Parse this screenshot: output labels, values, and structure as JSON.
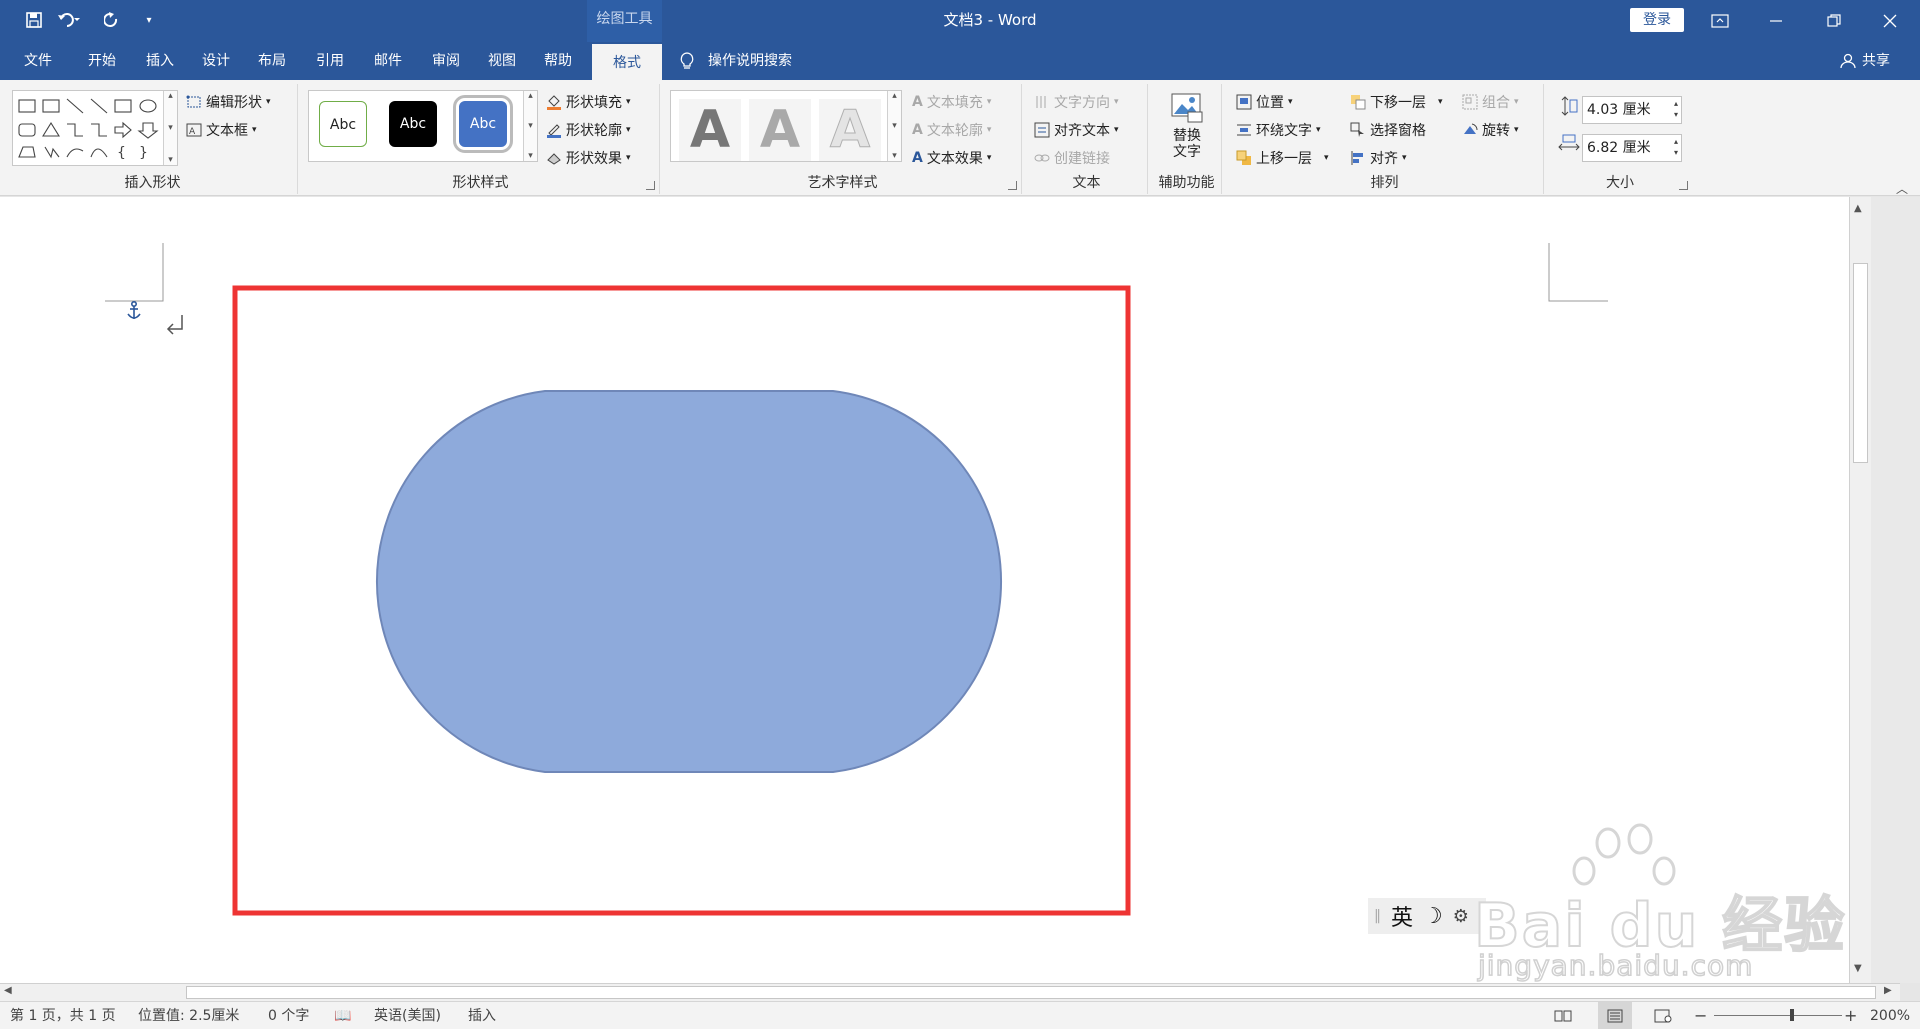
{
  "titlebar": {
    "context_tool": "绘图工具",
    "doc_title": "文档3 - Word",
    "login": "登录",
    "qat": [
      "save-icon",
      "undo-icon",
      "redo-icon",
      "customize-icon"
    ]
  },
  "tabs": [
    "文件",
    "开始",
    "插入",
    "设计",
    "布局",
    "引用",
    "邮件",
    "审阅",
    "视图",
    "帮助",
    "格式"
  ],
  "active_tab": "格式",
  "tellme": "操作说明搜索",
  "share": "共享",
  "ribbon": {
    "insert_shapes": {
      "edit_shape": "编辑形状",
      "text_box": "文本框",
      "label": "插入形状"
    },
    "shape_styles": {
      "samples": [
        "Abc",
        "Abc",
        "Abc"
      ],
      "fill": "形状填充",
      "outline": "形状轮廓",
      "effects": "形状效果",
      "label": "形状样式"
    },
    "wordart": {
      "sample": "A",
      "text_fill": "文本填充",
      "text_outline": "文本轮廓",
      "text_effects": "文本效果",
      "label": "艺术字样式"
    },
    "text": {
      "direction": "文字方向",
      "align": "对齐文本",
      "link": "创建链接",
      "label": "文本"
    },
    "accessibility": {
      "alt_text_1": "替换",
      "alt_text_2": "文字",
      "label": "辅助功能"
    },
    "arrange": {
      "position": "位置",
      "wrap": "环绕文字",
      "forward": "上移一层",
      "backward": "下移一层",
      "selection_pane": "选择窗格",
      "align": "对齐",
      "group": "组合",
      "rotate": "旋转",
      "label": "排列"
    },
    "size": {
      "height": "4.03 厘米",
      "width": "6.82 厘米",
      "label": "大小"
    }
  },
  "document": {
    "shape_fill": "#8eaadb",
    "shape_stroke": "#6f87b8",
    "highlight_color": "#ee3433",
    "ime": {
      "lang": "英"
    }
  },
  "watermark": {
    "text": "Bai du 经验",
    "url": "jingyan.baidu.com"
  },
  "status": {
    "page": "第 1 页，共 1 页",
    "position": "位置值: 2.5厘米",
    "words": "0 个字",
    "language": "英语(美国)",
    "mode": "插入",
    "zoom": "200%"
  },
  "colors": {
    "brand": "#2b579a",
    "ribbon_bg": "#f3f3f3"
  }
}
